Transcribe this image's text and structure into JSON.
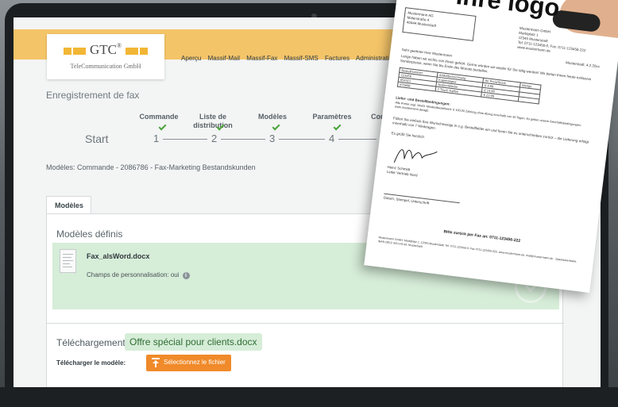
{
  "header": {
    "logo_text": "GTC",
    "logo_sub": "TeleCommunication GmbH",
    "nav": [
      "Aperçu",
      "Massif-Mail",
      "Massif-Fax",
      "Massif-SMS",
      "Factures",
      "Administration"
    ]
  },
  "page": {
    "title": "Enregistrement de fax"
  },
  "wizard": {
    "start_label": "Start",
    "steps": [
      {
        "label": "Commande",
        "number": "1",
        "done": true
      },
      {
        "label": "Liste de distribution",
        "number": "2",
        "done": true
      },
      {
        "label": "Modèles",
        "number": "3",
        "done": true
      },
      {
        "label": "Paramètres",
        "number": "4",
        "done": true
      },
      {
        "label": "Con",
        "number": "",
        "done": false
      }
    ]
  },
  "breadcrumb": {
    "text": "Modèles: Commande - 2086786 - Fax-Marketing Bestandskunden"
  },
  "tabs": [
    {
      "label": "Modèles",
      "active": true
    }
  ],
  "templates": {
    "section_title": "Modèles définis",
    "file_name": "Fax_alsWord.docx",
    "fields_label": "Champs de personnalisation: oui",
    "info_icon": "i"
  },
  "upload": {
    "title": "Téléchargement",
    "file_chip": "Offre spécial pour clients.docx",
    "model_label": "Télécharger le modèle:",
    "button_label": "Sélectionnez le fichier"
  },
  "letter": {
    "title": "Ihre logo",
    "sender_lines": [
      "Mustermann AG",
      "Malerstraße 4",
      "40444 Musterstadt"
    ],
    "company_lines": [
      "Mustermann GmbH",
      "Marktplatz 1",
      "12345 Musterstadt",
      "Tel. 0711-123456-0, Fax: 0711-123456-222",
      "www.mustermann.de"
    ],
    "date_line": "Musterstadt, 4.2.20xx",
    "salutation": "Sehr geehrter Herr Mustermann",
    "body": "Lange haben wir nichts von Ihnen gehört. Gerne würden wir wieder für Sie tätig werden! Wir bieten Ihnen heute exklusive Sonderpreise, wenn Sie bis Ende des Monats bestellen.",
    "table_rows": [
      [
        "Bestellnummer",
        "Artikelbezeichnung",
        "Ihr Preis/Stück",
        "Menge"
      ],
      [
        "123456",
        "Kopierpapier",
        "€ 4,99",
        ""
      ],
      [
        "654321",
        "Notizenblöcke",
        "€ 14,99",
        ""
      ],
      [
        "875698",
        "2 Touch Kaffee",
        "€ 22,99",
        ""
      ]
    ],
    "conditions_title": "Liefer- und Bestellbedingungen:",
    "conditions": "Alle Preise zzgl. MwSt. Mindestbestellwert: € 100,00 Zahlung ohne Abzug innerhalb von 30 Tagen. Es gelten unsere Geschäftsbedingungen: www.mustermann.de/agb",
    "instruction": "Füllen Sie einfach Ihre Wunschmenge in o.g. Bestellfelder ein und faxen Sie es unterschrieben zurück – die Lieferung erfolgt innerhalb von 7 Werktagen.",
    "greeting": "Es grüßt Sie herzlich",
    "signer": "Heinz Schmidt",
    "signer_role": "Leiter Vertrieb Nord",
    "signature_line": "Datum, Stempel, Unterschrift",
    "fax_back": "Bitte zurück per Fax an: 0711-123456-222",
    "footer": "Mustermann GmbH, Marktplatz 1, 12345 Musterstadt, Tel. 0711-123456-0, Fax 0711-123456-222, www.mustermann.de, mail@mustermann.de · Sparkassenbank, IBAN DE12 345 678 90, Musterbank"
  }
}
